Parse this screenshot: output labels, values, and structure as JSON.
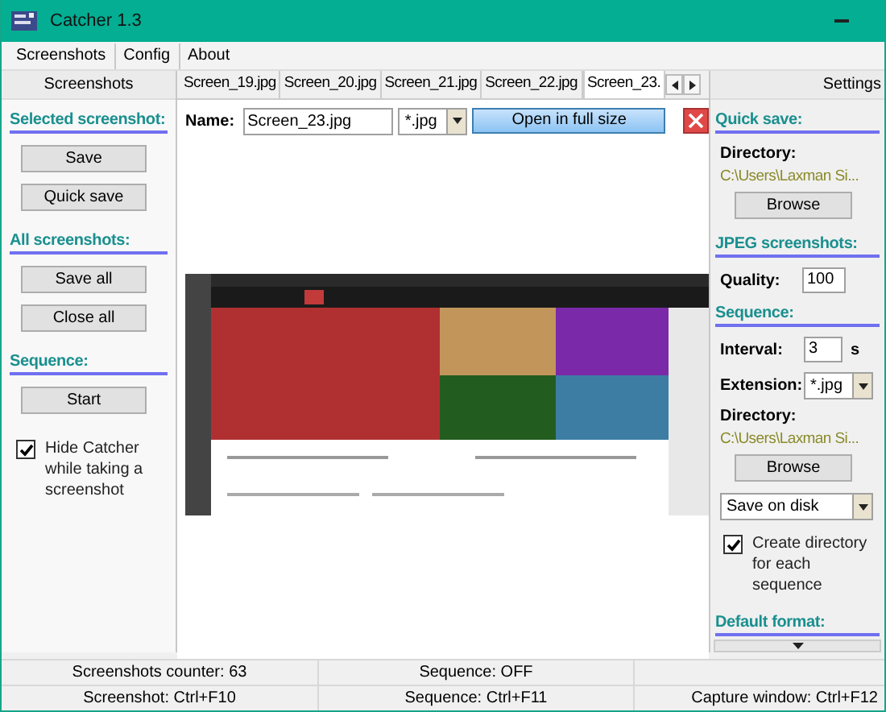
{
  "window": {
    "title": "Catcher 1.3"
  },
  "menu": [
    {
      "label": "Screenshots"
    },
    {
      "label": "Config"
    },
    {
      "label": "About"
    }
  ],
  "left_panel": {
    "header": "Screenshots",
    "sections": [
      {
        "heading": "Selected screenshot:",
        "buttons": [
          "Save",
          "Quick save"
        ]
      },
      {
        "heading": "All screenshots:",
        "buttons": [
          "Save all",
          "Close all"
        ]
      },
      {
        "heading": "Sequence:",
        "buttons": [
          "Start"
        ]
      }
    ],
    "hide_checkbox": {
      "label": "Hide Catcher while taking a screenshot",
      "checked": true
    }
  },
  "tabs": [
    {
      "label": "Screen_19.jpg",
      "selected": false
    },
    {
      "label": "Screen_20.jpg",
      "selected": false
    },
    {
      "label": "Screen_21.jpg",
      "selected": false
    },
    {
      "label": "Screen_22.jpg",
      "selected": false
    },
    {
      "label": "Screen_23.",
      "selected": true
    }
  ],
  "name_row": {
    "label": "Name:",
    "value": "Screen_23.jpg",
    "extension": "*.jpg",
    "open_button": "Open in full size"
  },
  "right_panel": {
    "header": "Settings",
    "quick_save": {
      "heading": "Quick save:",
      "directory_label": "Directory:",
      "directory_path": "C:\\Users\\Laxman Si...",
      "button": "Browse"
    },
    "jpeg": {
      "heading": "JPEG screenshots:",
      "quality_label": "Quality:",
      "quality_value": "100"
    },
    "sequence": {
      "heading": "Sequence:",
      "interval_label": "Interval:",
      "interval_value": "3",
      "interval_unit": "s",
      "extension_label": "Extension:",
      "extension_value": "*.jpg",
      "directory_label": "Directory:",
      "directory_path": "C:\\Users\\Laxman Si...",
      "button": "Browse",
      "mode": "Save on disk",
      "create_dir": {
        "label": "Create directory for each sequence",
        "checked": true
      }
    },
    "default_format": {
      "heading": "Default format:"
    }
  },
  "status_bar": [
    {
      "left": "Screenshots counter: 63",
      "center": "Sequence: OFF"
    },
    {
      "left": "Screenshot: Ctrl+F10",
      "center": "Sequence: Ctrl+F11",
      "right": "Capture window: Ctrl+F12"
    }
  ]
}
